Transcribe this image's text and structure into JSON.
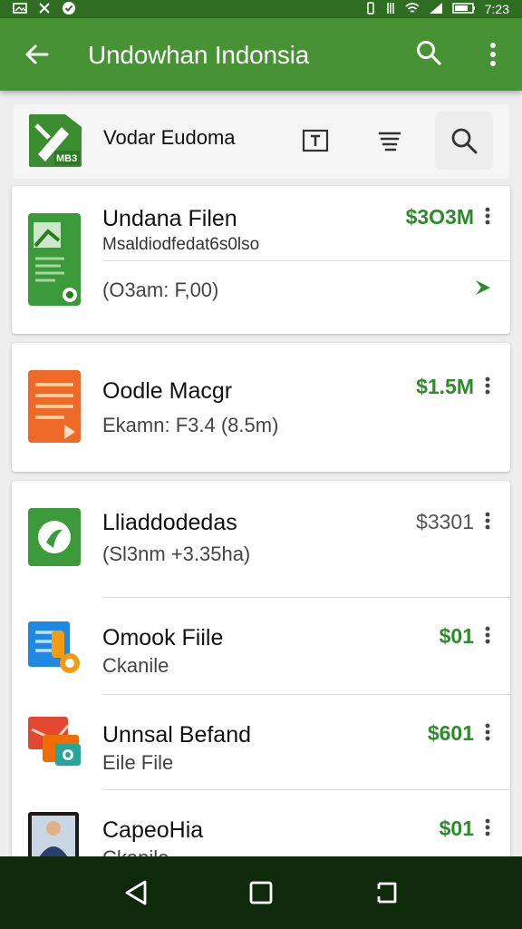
{
  "status_bar": {
    "left_icons": [
      "image-icon",
      "bug-icon",
      "shield-check-icon"
    ],
    "right_icons": [
      "vibrate-icon",
      "battery-saver-icon",
      "wifi-icon",
      "signal-icon",
      "battery-icon"
    ],
    "time": "7:23"
  },
  "app_bar": {
    "title": "Undowhan Indonsia",
    "background": "#469235"
  },
  "toolbar": {
    "app_badge": "MB3",
    "label": "Vodar Eudoma"
  },
  "list": {
    "items": [
      {
        "name": "Undana Filen",
        "line2": "Msaldiodfedat6s0lso",
        "line3": "(O3am: F,00)",
        "price": "$3O3M"
      },
      {
        "name": "Oodle Macgr",
        "line2": "Ekamn: F3.4 (8.5m)",
        "price": "$1.5M"
      },
      {
        "name": "Lliaddodedas",
        "line2": "(Sl3nm +3.35ha)",
        "price": "$3301"
      },
      {
        "name": "Omook Fiile",
        "line2": "Ckanile",
        "price": "$01"
      },
      {
        "name": "Unnsal Befand",
        "line2": "Eile File",
        "price": "$601"
      },
      {
        "name": "CapeoHia",
        "line2": "Ckanile",
        "price": "$01"
      }
    ]
  },
  "colors": {
    "accent_green": "#2e8b2a",
    "status_bar": "#2f6d22",
    "nav_bar": "#0f2a0b"
  }
}
